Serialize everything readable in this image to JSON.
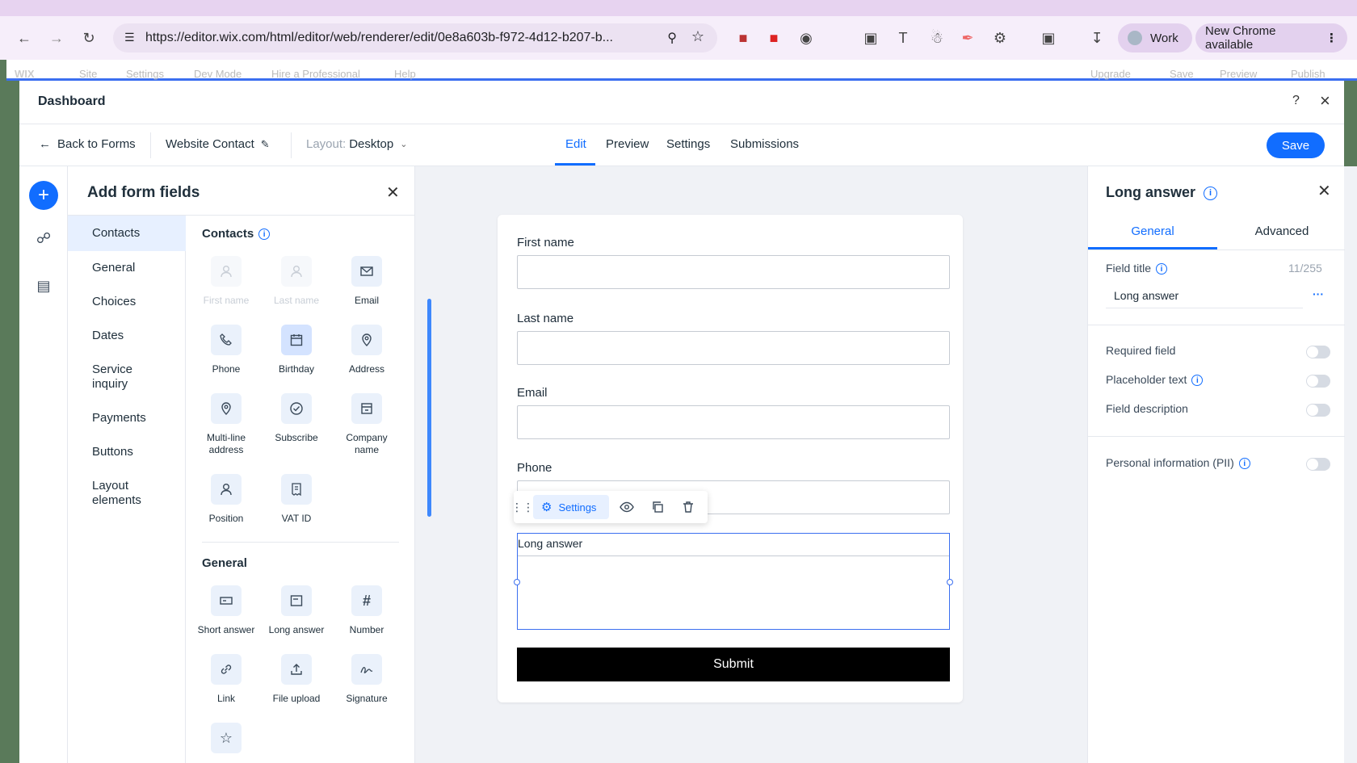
{
  "browser": {
    "url": "https://editor.wix.com/html/editor/web/renderer/edit/0e8a603b-f972-4d12-b207-b...",
    "profile_label": "Work",
    "update_label": "New Chrome available"
  },
  "wix_menu": [
    "Site",
    "Settings",
    "Dev Mode",
    "Hire a Professional",
    "Help",
    "Upgrade",
    "Save",
    "Preview",
    "Publish"
  ],
  "dashboard": {
    "title": "Dashboard",
    "help_icon": "?",
    "close_icon": "×"
  },
  "subbar": {
    "back_label": "Back to Forms",
    "form_name": "Website Contact",
    "layout_label": "Layout:",
    "layout_value": "Desktop",
    "tabs": [
      {
        "label": "Edit",
        "active": true
      },
      {
        "label": "Preview",
        "active": false
      },
      {
        "label": "Settings",
        "active": false
      },
      {
        "label": "Submissions",
        "active": false
      }
    ],
    "save_label": "Save"
  },
  "add_fields": {
    "title": "Add form fields",
    "categories": [
      "Contacts",
      "General",
      "Choices",
      "Dates",
      "Service inquiry",
      "Payments",
      "Buttons",
      "Layout elements"
    ],
    "contacts_section": "Contacts",
    "contacts": [
      {
        "label": "First name",
        "icon": "person-icon",
        "disabled": true
      },
      {
        "label": "Last name",
        "icon": "person-icon",
        "disabled": true
      },
      {
        "label": "Email",
        "icon": "mail-icon",
        "disabled": false
      },
      {
        "label": "Phone",
        "icon": "phone-icon",
        "disabled": false
      },
      {
        "label": "Birthday",
        "icon": "calendar-icon",
        "disabled": false
      },
      {
        "label": "Address",
        "icon": "pin-icon",
        "disabled": false
      },
      {
        "label": "Multi-line address",
        "icon": "pin-icon",
        "disabled": false
      },
      {
        "label": "Subscribe",
        "icon": "check-circle-icon",
        "disabled": false
      },
      {
        "label": "Company name",
        "icon": "store-icon",
        "disabled": false
      },
      {
        "label": "Position",
        "icon": "person-icon",
        "disabled": false
      },
      {
        "label": "VAT ID",
        "icon": "receipt-icon",
        "disabled": false
      }
    ],
    "general_section": "General",
    "general": [
      {
        "label": "Short answer",
        "icon": "short-text-icon"
      },
      {
        "label": "Long answer",
        "icon": "long-text-icon"
      },
      {
        "label": "Number",
        "icon": "hash-icon"
      },
      {
        "label": "Link",
        "icon": "link-icon"
      },
      {
        "label": "File upload",
        "icon": "upload-icon"
      },
      {
        "label": "Signature",
        "icon": "signature-icon"
      },
      {
        "label": "",
        "icon": "star-icon"
      }
    ]
  },
  "form": {
    "fields": [
      {
        "label": "First name"
      },
      {
        "label": "Last name"
      },
      {
        "label": "Email"
      },
      {
        "label": "Phone"
      }
    ],
    "long_answer_label": "Long answer",
    "toolbar_settings": "Settings",
    "submit_label": "Submit"
  },
  "right_panel": {
    "title": "Long answer",
    "tabs": [
      "General",
      "Advanced"
    ],
    "field_title_label": "Field title",
    "char_count": "11/255",
    "field_title_value": "Long answer",
    "more_icon": "···",
    "toggles": [
      {
        "label": "Required field",
        "info": false
      },
      {
        "label": "Placeholder text",
        "info": true
      },
      {
        "label": "Field description",
        "info": false
      },
      {
        "label": "Personal information (PII)",
        "info": true
      }
    ]
  },
  "colors": {
    "accent": "#116dff",
    "accent_light": "#e7f0ff"
  }
}
